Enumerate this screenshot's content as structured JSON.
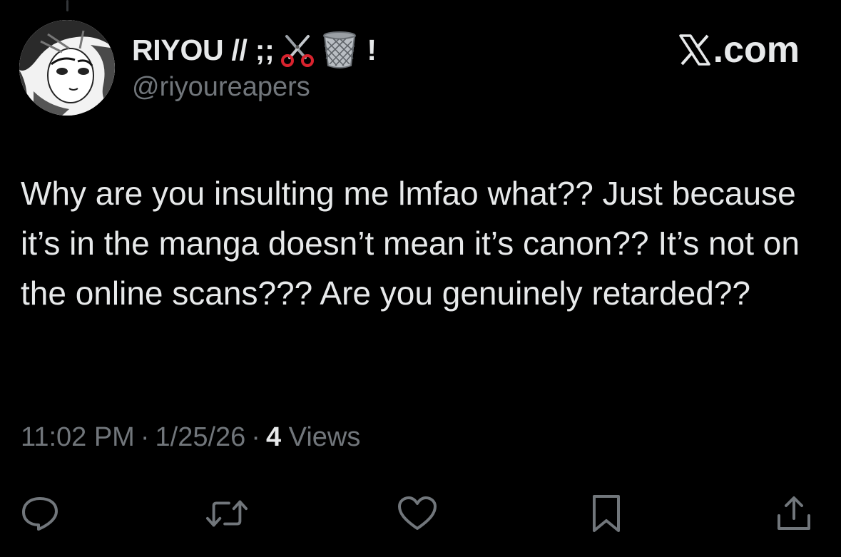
{
  "author": {
    "display_name": "RIYOU // ;;",
    "name_emojis": [
      "scissors-emoji",
      "wastebasket-emoji"
    ],
    "name_suffix": "!",
    "handle": "@riyoureapers",
    "avatar": "avatar-image"
  },
  "brand": {
    "logo": "x-logo-icon",
    "label": ".com"
  },
  "tweet": {
    "text": "Why are you insulting me lmfao what?? Just because it’s in the manga doesn’t mean it’s canon?? It’s not on the online scans??? Are you genuinely retarded??",
    "time": "11:02 PM",
    "separator": "·",
    "date": "1/25/26",
    "views_count": "4",
    "views_label": "Views"
  },
  "actions": [
    {
      "name": "reply",
      "icon": "reply-icon"
    },
    {
      "name": "retweet",
      "icon": "retweet-icon"
    },
    {
      "name": "like",
      "icon": "heart-icon"
    },
    {
      "name": "bookmark",
      "icon": "bookmark-icon"
    },
    {
      "name": "share",
      "icon": "share-icon"
    }
  ],
  "colors": {
    "background": "#000000",
    "primary_text": "#e7e9ea",
    "secondary_text": "#71767b",
    "scissors_red": "#d9232e"
  }
}
